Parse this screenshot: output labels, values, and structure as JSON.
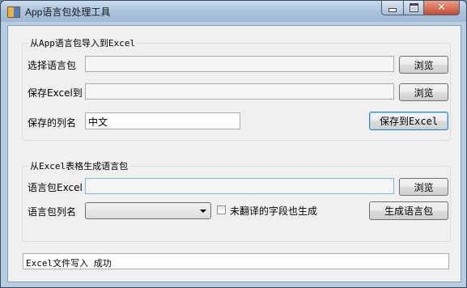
{
  "window": {
    "title": "App语言包处理工具"
  },
  "import_group": {
    "title": "从App语言包导入到Excel",
    "select_pack_label": "选择语言包",
    "select_pack_value": "",
    "browse1": "浏览",
    "save_excel_label": "保存Excel到",
    "save_excel_value": "",
    "browse2": "浏览",
    "column_label": "保存的列名",
    "column_value": "中文",
    "save_button": "保存到Excel"
  },
  "generate_group": {
    "title": "从Excel表格生成语言包",
    "excel_label": "语言包Excel",
    "excel_value": "",
    "browse3": "浏览",
    "column_label": "语言包列名",
    "column_selected": "",
    "untranslated_label": "未翻译的字段也生成",
    "untranslated_checked": false,
    "generate_button": "生成语言包"
  },
  "status": {
    "text": "Excel文件写入 成功"
  }
}
